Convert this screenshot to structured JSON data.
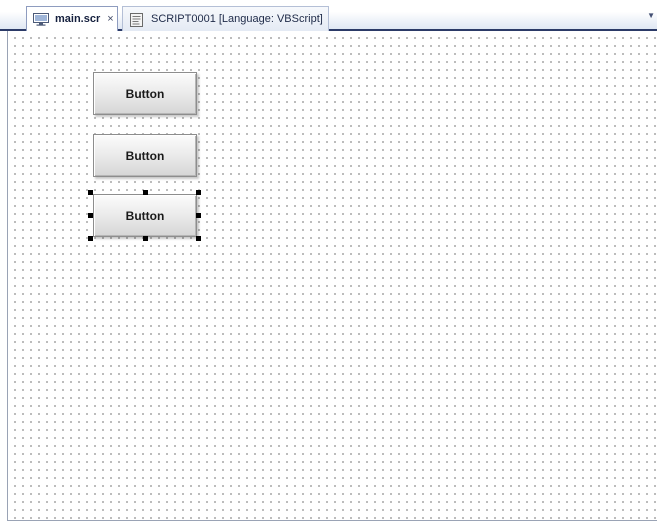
{
  "tabs": [
    {
      "label": "main.scr",
      "close": "×",
      "icon": "screen-icon",
      "active": true
    },
    {
      "label": "SCRIPT0001 [Language: VBScript]",
      "icon": "script-icon",
      "active": false
    }
  ],
  "overflow_icon": "▼",
  "canvas": {
    "grid": true,
    "buttons": [
      {
        "label": "Button",
        "selected": false
      },
      {
        "label": "Button",
        "selected": false
      },
      {
        "label": "Button",
        "selected": true
      }
    ]
  }
}
